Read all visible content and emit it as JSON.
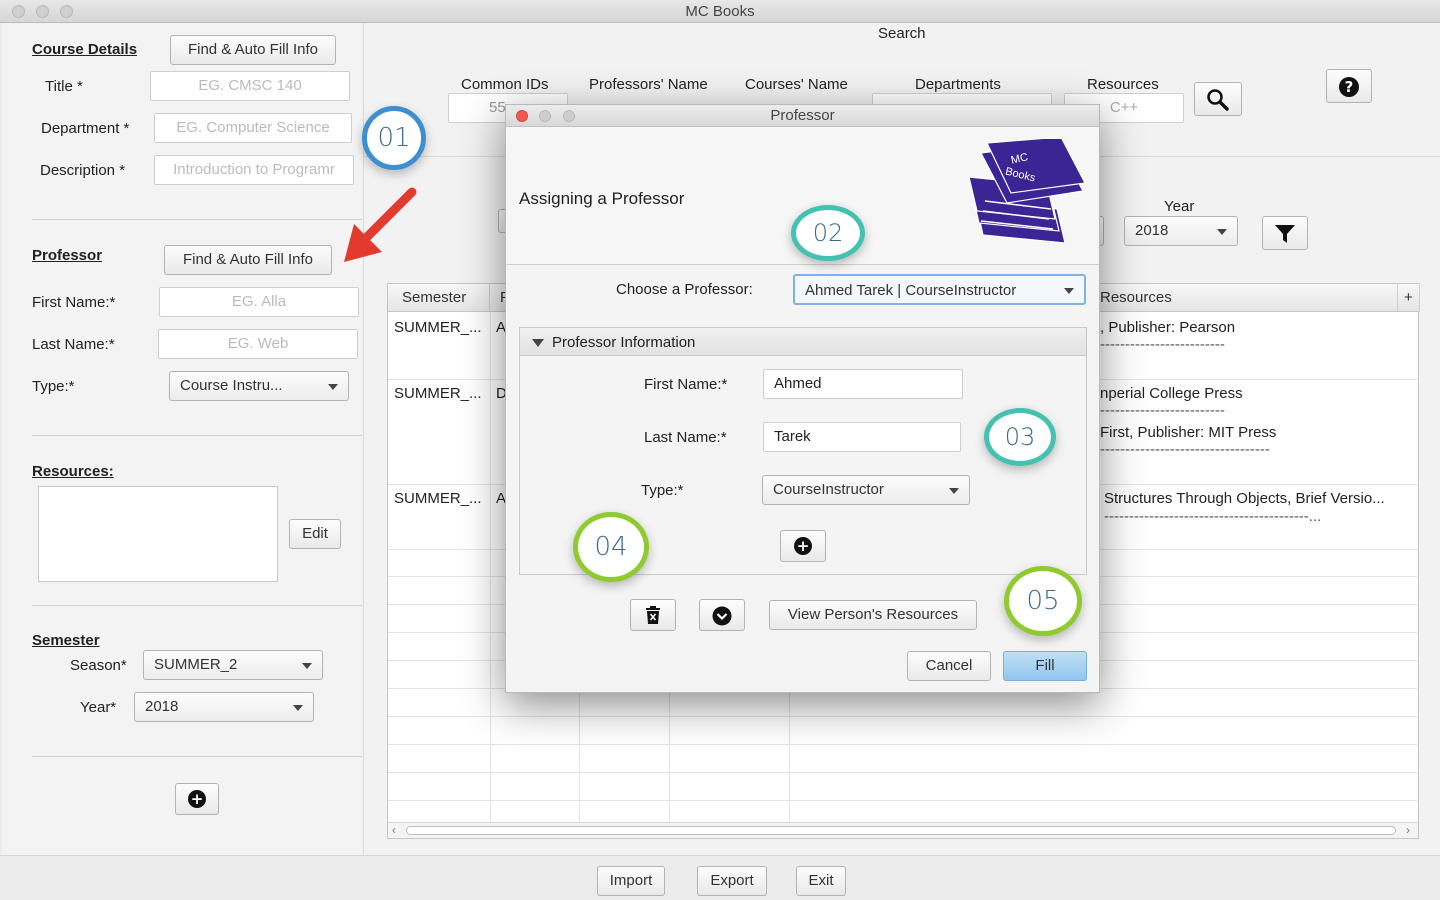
{
  "window": {
    "title": "MC Books"
  },
  "left": {
    "course_details": {
      "header": "Course Details",
      "find_button": "Find & Auto Fill Info",
      "title_label": "Title *",
      "title_placeholder": "EG. CMSC 140",
      "department_label": "Department *",
      "department_placeholder": "EG.  Computer Science",
      "description_label": "Description *",
      "description_placeholder": "Introduction to Programr"
    },
    "professor": {
      "header": "Professor",
      "find_button": "Find & Auto Fill Info",
      "first_label": "First Name:*",
      "first_placeholder": "EG. Alla",
      "last_label": "Last Name:*",
      "last_placeholder": "EG. Web",
      "type_label": "Type:*",
      "type_value": "Course Instru..."
    },
    "resources": {
      "header": "Resources:",
      "edit_button": "Edit"
    },
    "semester": {
      "header": "Semester",
      "season_label": "Season*",
      "season_value": "SUMMER_2",
      "year_label": "Year*",
      "year_value": "2018"
    }
  },
  "search": {
    "title": "Search",
    "columns": [
      "Common IDs",
      "Professors' Name",
      "Courses' Name",
      "Departments",
      "Resources"
    ],
    "common_ids_partial": "55",
    "resources_value": "C++",
    "year_label": "Year",
    "year_value": "2018"
  },
  "table": {
    "headers": [
      "Semester",
      "P",
      "Resources"
    ],
    "rows": [
      {
        "semester": "SUMMER_...",
        "p": "A",
        "res1": ", Publisher: Pearson",
        "res2": "-------------------------"
      },
      {
        "semester": "SUMMER_...",
        "p": "D",
        "res1": "nperial College Press",
        "res2": "-------------------------",
        "res3": "First, Publisher: MIT Press",
        "res4": "----------------------------------"
      },
      {
        "semester": "SUMMER_...",
        "p": "A",
        "res1": "Structures Through Objects, Brief Versio...",
        "res2": "-----------------------------------------..."
      }
    ]
  },
  "bottom": {
    "import": "Import",
    "export": "Export",
    "exit": "Exit"
  },
  "dialog": {
    "title": "Professor",
    "heading": "Assigning a Professor",
    "logo_text_1": "MC",
    "logo_text_2": "Books",
    "choose_label": "Choose a Professor:",
    "choose_value": "Ahmed Tarek | CourseInstructor",
    "section": "Professor Information",
    "first_label": "First Name:*",
    "first_value": "Ahmed",
    "last_label": "Last Name:*",
    "last_value": "Tarek",
    "type_label": "Type:*",
    "type_value": "CourseInstructor",
    "view_resources": "View Person's Resources",
    "cancel": "Cancel",
    "fill": "Fill"
  },
  "markers": [
    "01",
    "02",
    "03",
    "04",
    "05"
  ],
  "colors": {
    "accent_blue": "#3d8fd1",
    "teal": "#43c2b2",
    "green": "#8fcb2f",
    "arrow_red": "#e23b2e",
    "fill_button": "#a9d2f1"
  }
}
